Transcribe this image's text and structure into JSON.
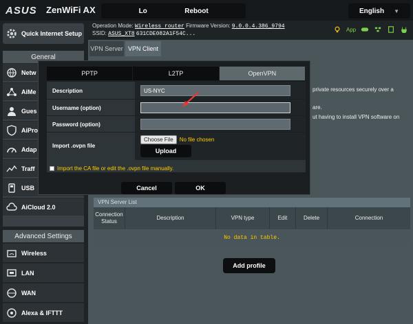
{
  "header": {
    "logo": "ASUS",
    "model": "ZenWiFi AX",
    "logout_label": "Logout",
    "reboot_label": "Reboot",
    "language": "English"
  },
  "info": {
    "operation_mode_label": "Operation Mode:",
    "operation_mode_value": "Wireless router",
    "firmware_label": "Firmware Version:",
    "firmware_value": "9.0.0.4.386_9794",
    "ssid_label": "SSID:",
    "ssid_value": "ASUS_XT8",
    "ssid_extra": "631CDE082A1F54C...",
    "app_label": "App"
  },
  "sidebar": {
    "quick_setup": "Quick Internet Setup",
    "general_title": "General",
    "general_items": [
      {
        "label": "Netw",
        "icon": "globe-icon"
      },
      {
        "label": "AiMe",
        "icon": "mesh-icon"
      },
      {
        "label": "Gues",
        "icon": "guest-icon"
      },
      {
        "label": "AiPro",
        "icon": "shield-icon"
      },
      {
        "label": "Adap",
        "icon": "gauge-icon"
      },
      {
        "label": "Traff",
        "icon": "traffic-icon"
      },
      {
        "label": "USB",
        "icon": "usb-icon"
      },
      {
        "label": "AiCloud 2.0",
        "icon": "cloud-icon"
      }
    ],
    "advanced_title": "Advanced Settings",
    "advanced_items": [
      {
        "label": "Wireless",
        "icon": "wifi-icon"
      },
      {
        "label": "LAN",
        "icon": "lan-icon"
      },
      {
        "label": "WAN",
        "icon": "wan-icon"
      },
      {
        "label": "Alexa & IFTTT",
        "icon": "alexa-icon"
      }
    ]
  },
  "tabs": {
    "server": "VPN Server",
    "client": "VPN Client"
  },
  "content": {
    "text1": "private resources securely over a",
    "text2": "are.",
    "text3": "ut having to install VPN software on",
    "list_title": "VPN Server List",
    "columns": [
      "Connection Status",
      "Description",
      "VPN type",
      "Edit",
      "Delete",
      "Connection"
    ],
    "empty_text": "No data in table.",
    "add_profile": "Add profile"
  },
  "modal": {
    "tabs": [
      "PPTP",
      "L2TP",
      "OpenVPN"
    ],
    "description_label": "Description",
    "description_value": "US-NYC",
    "username_label": "Username (option)",
    "username_value": "",
    "password_label": "Password (option)",
    "password_value": "",
    "ovpn_label": "Import .ovpn file",
    "choose_file": "Choose File",
    "no_file": "No file chosen",
    "upload": "Upload",
    "ca_text": "Import the CA file or edit the .ovpn file manually.",
    "cancel": "Cancel",
    "ok": "OK"
  },
  "colors": {
    "accent_yellow": "#ffcc00",
    "app_green": "#7cd14b",
    "arrow_red": "#e53935"
  }
}
